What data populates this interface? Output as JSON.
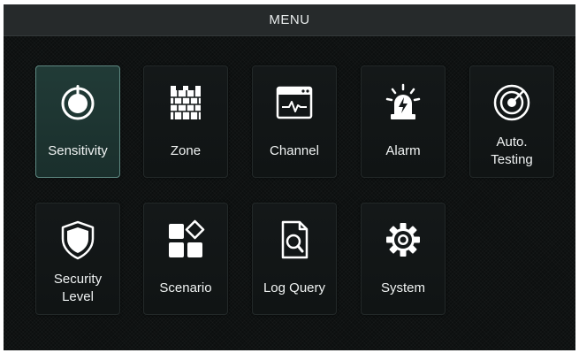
{
  "header": {
    "title": "MENU"
  },
  "menu": {
    "items": [
      {
        "label": "Sensitivity",
        "icon": "power-knob-icon",
        "active": true
      },
      {
        "label": "Zone",
        "icon": "brick-wall-icon",
        "active": false
      },
      {
        "label": "Channel",
        "icon": "signal-window-icon",
        "active": false
      },
      {
        "label": "Alarm",
        "icon": "siren-icon",
        "active": false
      },
      {
        "label": "Auto.\nTesting",
        "icon": "radar-icon",
        "active": false
      },
      {
        "label": "Security\nLevel",
        "icon": "shield-icon",
        "active": false
      },
      {
        "label": "Scenario",
        "icon": "scenario-grid-icon",
        "active": false
      },
      {
        "label": "Log Query",
        "icon": "document-search-icon",
        "active": false
      },
      {
        "label": "System",
        "icon": "gear-icon",
        "active": false
      }
    ]
  },
  "colors": {
    "background": "#0c0f0f",
    "title_bar": "#262a2b",
    "tile": "#141819",
    "active_tile": "#213b37",
    "active_border": "#5f8a83",
    "icon": "#ffffff",
    "text": "#f0f3f3"
  }
}
